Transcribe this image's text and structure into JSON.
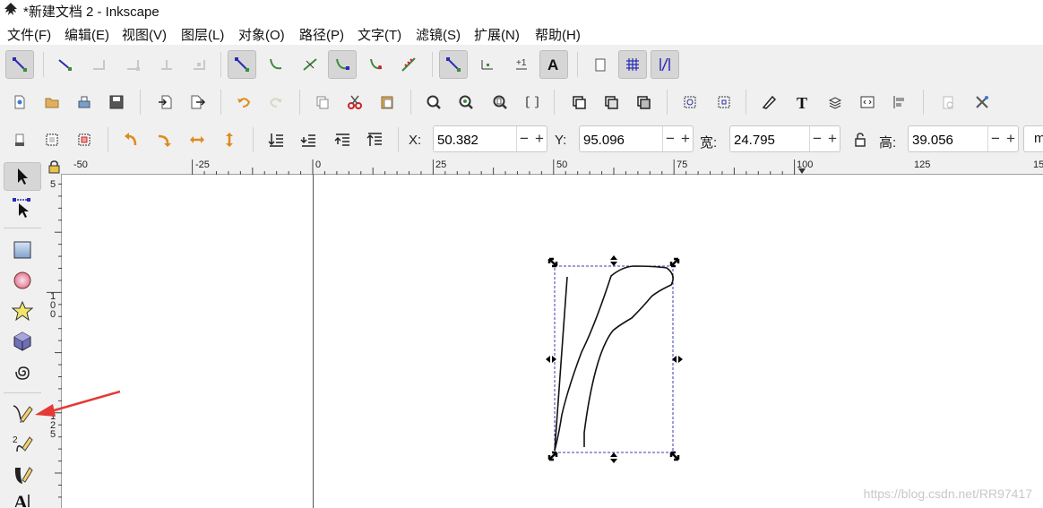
{
  "window": {
    "title": "*新建文档 2 - Inkscape"
  },
  "menubar": {
    "items": [
      "文件(F)",
      "编辑(E)",
      "视图(V)",
      "图层(L)",
      "对象(O)",
      "路径(P)",
      "文字(T)",
      "滤镜(S)",
      "扩展(N)",
      "帮助(H)"
    ]
  },
  "selector_bar": {
    "x_label": "X:",
    "x_value": "50.382",
    "y_label": "Y:",
    "y_value": "95.096",
    "w_label": "宽:",
    "w_value": "24.795",
    "h_label": "高:",
    "h_value": "39.056",
    "minus": "−",
    "plus": "+",
    "unit": "m"
  },
  "hruler": {
    "labels": [
      "-50",
      "-25",
      "0",
      "25",
      "50",
      "75",
      "100",
      "125",
      "15"
    ]
  },
  "vruler": {
    "labels": [
      "5",
      "1\n0\n0",
      "1\n2\n5"
    ]
  },
  "watermark": "https://blog.csdn.net/RR97417",
  "colors": {
    "accent_green": "#3a8a3a",
    "selection_dash": "#3b3bb0",
    "annotation_arrow": "#e53935"
  }
}
